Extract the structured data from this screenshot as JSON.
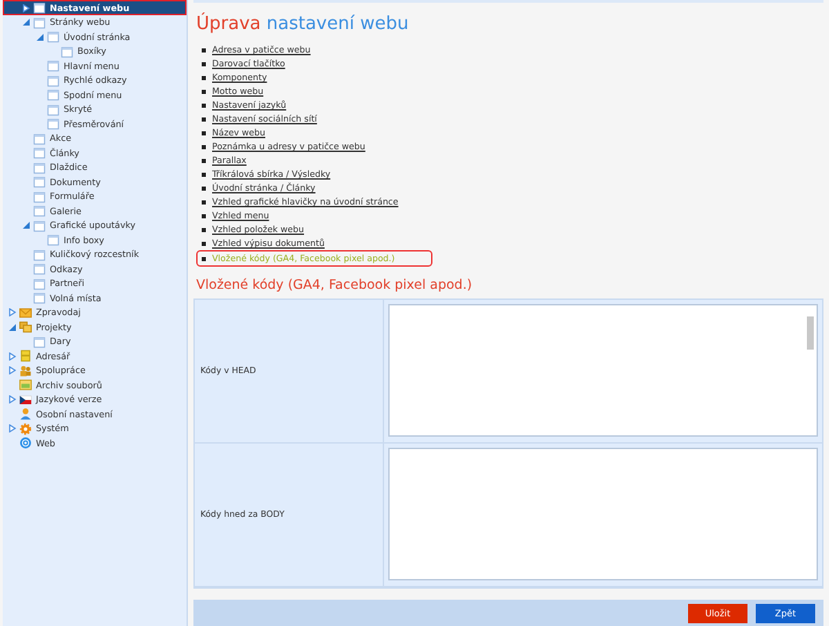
{
  "sidebar": {
    "web_tree": [
      {
        "label": "Nastavení webu",
        "kind": "page",
        "selected": true,
        "expanded": false
      },
      {
        "label": "Stránky webu",
        "kind": "page",
        "selected": false,
        "expanded": true,
        "children": [
          {
            "label": "Úvodní stránka",
            "kind": "page",
            "selected": false,
            "expanded": true,
            "children": [
              {
                "label": "Boxíky",
                "kind": "page",
                "selected": false
              }
            ]
          },
          {
            "label": "Hlavní menu",
            "kind": "page",
            "selected": false
          },
          {
            "label": "Rychlé odkazy",
            "kind": "page",
            "selected": false
          },
          {
            "label": "Spodní menu",
            "kind": "page",
            "selected": false
          },
          {
            "label": "Skryté",
            "kind": "page",
            "selected": false
          },
          {
            "label": "Přesměrování",
            "kind": "page",
            "selected": false
          }
        ]
      },
      {
        "label": "Akce",
        "kind": "page",
        "selected": false
      },
      {
        "label": "Články",
        "kind": "page",
        "selected": false
      },
      {
        "label": "Dlaždice",
        "kind": "page",
        "selected": false
      },
      {
        "label": "Dokumenty",
        "kind": "page",
        "selected": false
      },
      {
        "label": "Formuláře",
        "kind": "page",
        "selected": false
      },
      {
        "label": "Galerie",
        "kind": "page",
        "selected": false
      },
      {
        "label": "Grafické upoutávky",
        "kind": "page",
        "selected": false,
        "expanded": true,
        "children": [
          {
            "label": "Info boxy",
            "kind": "page",
            "selected": false
          }
        ]
      },
      {
        "label": "Kuličkový rozcestník",
        "kind": "page",
        "selected": false
      },
      {
        "label": "Odkazy",
        "kind": "page",
        "selected": false
      },
      {
        "label": "Partneři",
        "kind": "page",
        "selected": false
      },
      {
        "label": "Volná místa",
        "kind": "page",
        "selected": false
      }
    ],
    "modules": [
      {
        "label": "Zpravodaj",
        "kind": "mail",
        "selected": false,
        "expanded": false
      },
      {
        "label": "Projekty",
        "kind": "folders",
        "selected": false,
        "expanded": true,
        "children": [
          {
            "label": "Dary",
            "kind": "page",
            "selected": false
          }
        ]
      },
      {
        "label": "Adresář",
        "kind": "book",
        "selected": false,
        "expanded": false
      },
      {
        "label": "Spolupráce",
        "kind": "people",
        "selected": false,
        "expanded": false
      },
      {
        "label": "Archiv souborů",
        "kind": "archive",
        "selected": false
      },
      {
        "label": "Jazykové verze",
        "kind": "flag",
        "selected": false,
        "expanded": false
      },
      {
        "label": "Osobní nastavení",
        "kind": "person",
        "selected": false
      },
      {
        "label": "Systém",
        "kind": "gear",
        "selected": false,
        "expanded": false
      },
      {
        "label": "Web",
        "kind": "globe",
        "selected": false
      }
    ]
  },
  "main": {
    "title_prefix": "Úprava",
    "title": "nastavení webu",
    "links": [
      {
        "label": "Adresa v patičce webu",
        "selected": false
      },
      {
        "label": "Darovací tlačítko",
        "selected": false
      },
      {
        "label": "Komponenty",
        "selected": false
      },
      {
        "label": "Motto webu",
        "selected": false
      },
      {
        "label": "Nastavení jazyků",
        "selected": false
      },
      {
        "label": "Nastavení sociálních sítí",
        "selected": false
      },
      {
        "label": "Název webu",
        "selected": false
      },
      {
        "label": "Poznámka u adresy v patičce webu",
        "selected": false
      },
      {
        "label": "Parallax",
        "selected": false
      },
      {
        "label": "Tříkrálová sbírka / Výsledky",
        "selected": false
      },
      {
        "label": "Úvodní stránka / Články",
        "selected": false
      },
      {
        "label": "Vzhled grafické hlavičky na úvodní stránce",
        "selected": false
      },
      {
        "label": "Vzhled menu",
        "selected": false
      },
      {
        "label": "Vzhled položek webu",
        "selected": false
      },
      {
        "label": "Vzhled výpisu dokumentů",
        "selected": false
      },
      {
        "label": "Vložené kódy (GA4, Facebook pixel apod.)",
        "selected": true
      }
    ],
    "section_title": "Vložené kódy (GA4, Facebook pixel apod.)",
    "fields": [
      {
        "label": "Kódy v HEAD"
      },
      {
        "label": "Kódy hned za BODY"
      }
    ],
    "buttons": [
      {
        "label": "Uložit",
        "kind": "save"
      },
      {
        "label": "Zpět",
        "kind": "back"
      }
    ]
  }
}
